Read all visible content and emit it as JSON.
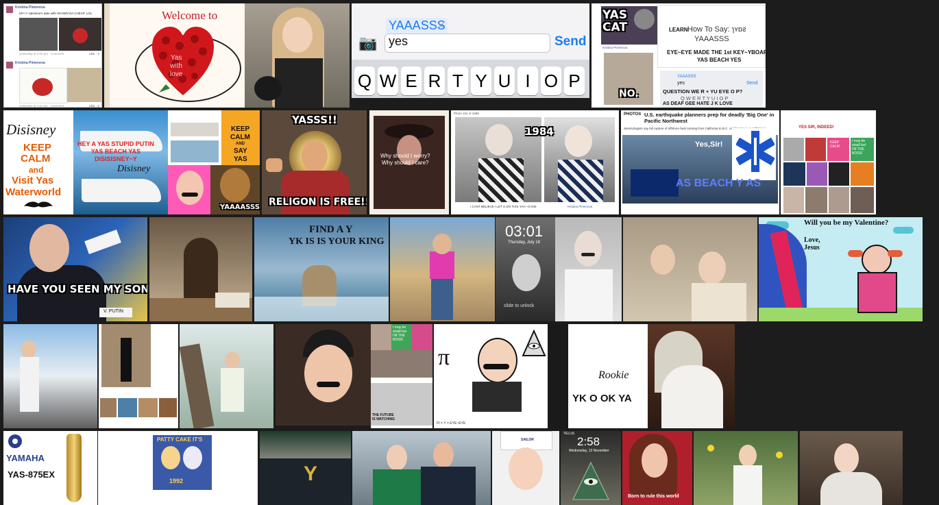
{
  "tiles": {
    "fb1": {
      "name": "Kristina Pimenova",
      "post": "MY+Y valentine's date with SHAWN DA CHEAP. LOL",
      "meta": "yesterday at 2:01 pm · Comment",
      "like": "Like · 3",
      "name2": "Kristina Pimenova",
      "meta2": "yesterday at 1:11 pm · Comment",
      "like2": "Like · 2"
    },
    "welcome": {
      "title": "Welcome to",
      "heart_text": "Yas\nwith\nlove"
    },
    "keyboard": {
      "token": "YAAASSS",
      "input": "yes",
      "send": "Send",
      "keys": [
        "Q",
        "W",
        "E",
        "R",
        "T",
        "Y",
        "U",
        "I",
        "O",
        "P"
      ]
    },
    "yascat": {
      "cat_label": "YAS\nCAT",
      "name": "Kristina Pimenova",
      "no": "NO.",
      "learn": "LEARN",
      "how_to": "How To Say: ɿʏɒƨ",
      "yaaasss": "YAAASSS",
      "eye_text": "EYE~EYE MADE THE 1st KEY~YBOARD\nYAS BEACH YES",
      "token": "YAAASSS",
      "input": "yes",
      "send": "Send",
      "keys": "Q W E R T Y U I O P",
      "question": "QUESTION WE R + YU   EYE  O   P?",
      "deaf": "AS DEAF GEE HATE J K LOVE"
    },
    "disney": {
      "brand": "Disisney",
      "line1": "KEEP",
      "line2": "CALM",
      "line3": "and",
      "line4": "Visit Yas",
      "line5": "Waterworld"
    },
    "putin_yacht": {
      "caption": "HEY A YAS STUPID PUTIN\nYAS BEACH YAS\nDISISISNEY~Y",
      "brand": "Disisney"
    },
    "keepcalm": {
      "line1": "KEEP",
      "line2": "CALM",
      "line3": "AND",
      "line4": "SAY",
      "line5": "YAS"
    },
    "lion": {
      "caption": "YAAAASSS"
    },
    "jesus": {
      "top": "YASSS!!",
      "bottom": "RELIGON IS FREE!!"
    },
    "girl_hat": {
      "caption": "Why should I worry?\nWhy should I care?"
    },
    "photos1984": {
      "header": "Photo 151 of 1589",
      "number": "1984",
      "caption": "I CANT BELIEVE I LET U DO THIS YAH ~O EW",
      "name": "Kristina Pimenova"
    },
    "news": {
      "label": "PHOTOS",
      "headline": "U.S. earthquake planners prep for deadly 'Big One' in Pacific Northwest",
      "sub": "Seismologists say full rupture of offshore fault running from California to B.C. could come in our lifetimes",
      "yes_sir": "Yes,Sir!",
      "beach": "AS BEACH  Y AS"
    },
    "collage": {
      "top": "YES SIR, INDEED!",
      "k1": "KEEP\nCALM",
      "k2": "I may be\nsmall but\nI'M THE\nBOSS!"
    },
    "putin_son": {
      "caption": "HAVE YOU SEEN MY SON?",
      "plate": "V. PUTIN"
    },
    "findy": {
      "title": "FIND A Y",
      "sub": "YK IS IS YOUR KING"
    },
    "lock": {
      "time": "03:01",
      "date": "Thursday, July 18",
      "slide": "slide to unlock"
    },
    "valentine": {
      "title": "Will you be my Valentine?",
      "sub": "Love,\nJesus"
    },
    "fb2": {
      "bubble_text": "I may be\nsmall but\nI'M THE\nBOSS!",
      "future": "THE FUTURE\nIS WATCHING"
    },
    "pi": {
      "symbol": "π",
      "caption": "PI = Y = EYE~EYE"
    },
    "rookie": {
      "logo": "Rookie",
      "caption": "YK O OK YA"
    },
    "yamaha": {
      "brand": "YAMAHA",
      "model": "YAS-875EX"
    },
    "pattycake": {
      "caption": "PATTY CAKE IT'S",
      "year": "1992"
    },
    "y_letter": {
      "letter": "Y"
    },
    "phone": {
      "carrier": "TELUS",
      "time": "2:58",
      "date": "Wednesday, 13 November",
      "sailor": "SAILOR"
    },
    "born": {
      "caption": "Born to rule this world"
    }
  },
  "colors": {
    "background": "#1c1c1c",
    "heart_red": "#d0181c",
    "send_blue": "#1a7cf5",
    "keepcalm_orange": "#f5a623",
    "valentine_bg": "#c4ecf2"
  }
}
